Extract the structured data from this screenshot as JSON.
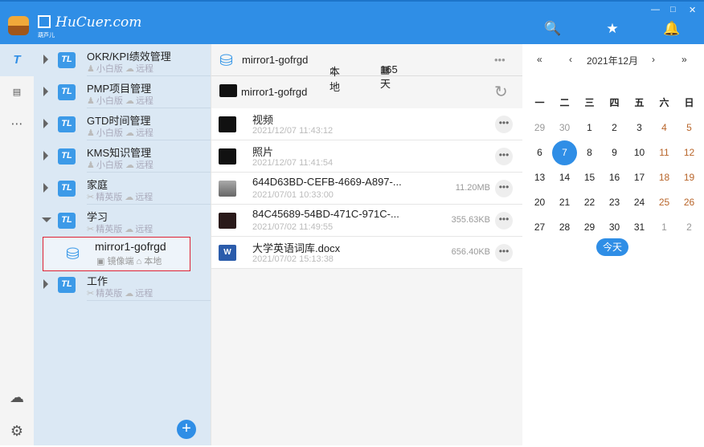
{
  "app": {
    "brand": "HuCuer.com",
    "brand_sub": "葫芦儿"
  },
  "window": {
    "minimize": "—",
    "maximize": "□",
    "close": "✕"
  },
  "tree": [
    {
      "name": "OKR/KPI绩效管理",
      "edition": "小白版",
      "location": "远程",
      "expanded": false
    },
    {
      "name": "PMP项目管理",
      "edition": "小白版",
      "location": "远程",
      "expanded": false
    },
    {
      "name": "GTD时间管理",
      "edition": "小白版",
      "location": "远程",
      "expanded": false
    },
    {
      "name": "KMS知识管理",
      "edition": "小白版",
      "location": "远程",
      "expanded": false
    },
    {
      "name": "家庭",
      "edition": "精英版",
      "location": "远程",
      "expanded": false
    },
    {
      "name": "学习",
      "edition": "精英版",
      "location": "远程",
      "expanded": true
    },
    {
      "name": "工作",
      "edition": "精英版",
      "location": "远程",
      "expanded": false
    }
  ],
  "mirror": {
    "name": "mirror1-gofrgd",
    "type": "镜像端",
    "location": "本地"
  },
  "main": {
    "title": "mirror1-gofrgd",
    "location": "本地",
    "days": "165天",
    "path": "mirror1-gofrgd",
    "files": [
      {
        "name": "视频",
        "date": "2021/12/07 11:43:12",
        "size": "",
        "kind": "cloud-folder"
      },
      {
        "name": "照片",
        "date": "2021/12/07 11:41:54",
        "size": "",
        "kind": "cloud-folder"
      },
      {
        "name": "644D63BD-CEFB-4669-A897-...",
        "date": "2021/07/01 10:33:00",
        "size": "11.20MB",
        "kind": "image"
      },
      {
        "name": "84C45689-54BD-471C-971C-...",
        "date": "2021/07/02 11:49:55",
        "size": "355.63KB",
        "kind": "image-dark"
      },
      {
        "name": "大学英语词库.docx",
        "date": "2021/07/02 15:13:38",
        "size": "656.40KB",
        "kind": "word"
      }
    ]
  },
  "calendar": {
    "prev_year": "«",
    "prev_month": "‹",
    "title": "2021年12月",
    "next_month": "›",
    "next_year": "»",
    "weekdays": [
      "一",
      "二",
      "三",
      "四",
      "五",
      "六",
      "日"
    ],
    "days": [
      "29",
      "30",
      "1",
      "2",
      "3",
      "4",
      "5",
      "6",
      "7",
      "8",
      "9",
      "10",
      "11",
      "12",
      "13",
      "14",
      "15",
      "16",
      "17",
      "18",
      "19",
      "20",
      "21",
      "22",
      "23",
      "24",
      "25",
      "26",
      "27",
      "28",
      "29",
      "30",
      "31",
      "1",
      "2"
    ],
    "selected": "7",
    "today_label": "今天"
  }
}
